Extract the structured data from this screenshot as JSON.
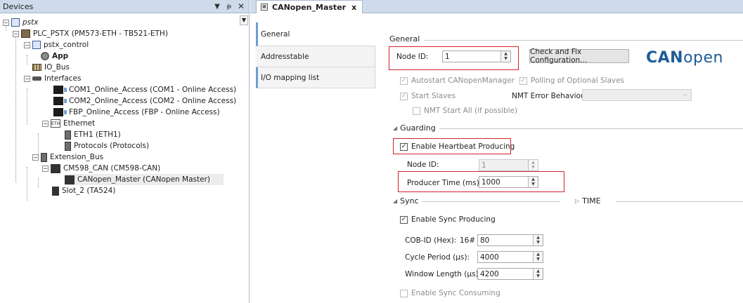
{
  "devices_panel": {
    "title": "Devices",
    "pin_icon": "pin-icon",
    "items": {
      "pstx": "pstx",
      "plc": "PLC_PSTX (PM573-ETH - TB521-ETH)",
      "pstx_control": "pstx_control",
      "app": "App",
      "io_bus": "IO_Bus",
      "interfaces": "Interfaces",
      "com1": "COM1_Online_Access (COM1 - Online Access)",
      "com2": "COM2_Online_Access (COM2 - Online Access)",
      "fbp": "FBP_Online_Access (FBP - Online Access)",
      "ethernet": "Ethernet",
      "eth1": "ETH1 (ETH1)",
      "protocols": "Protocols (Protocols)",
      "extension_bus": "Extension_Bus",
      "cm598": "CM598_CAN (CM598-CAN)",
      "canopen_master": "CANopen_Master (CANopen Master)",
      "slot2": "Slot_2 (TA524)"
    }
  },
  "editor": {
    "tab_title": "CANopen_Master",
    "tab_close": "x",
    "side_tabs": [
      "General",
      "Addresstable",
      "I/O mapping list"
    ],
    "general": {
      "section": "General",
      "node_id_label": "Node ID:",
      "node_id_value": "1",
      "check_fix_button": "Check and Fix Configuration...",
      "logo_can": "CAN",
      "logo_open": "open",
      "autostart": "Autostart CANopenManager",
      "polling": "Polling of Optional Slaves",
      "start_slaves": "Start Slaves",
      "nmt_error_label": "NMT Error Behaviour:",
      "nmt_start_all": "NMT Start All (if possible)"
    },
    "guarding": {
      "section": "Guarding",
      "enable_heartbeat": "Enable Heartbeat Producing",
      "node_id_label": "Node ID:",
      "node_id_value": "1",
      "producer_time_label": "Producer Time (ms):",
      "producer_time_value": "1000"
    },
    "sync": {
      "section": "Sync",
      "time_section": "TIME",
      "enable_sync": "Enable Sync Producing",
      "cob_id_label": "COB-ID (Hex):",
      "cob_id_prefix": "16#",
      "cob_id_value": "80",
      "cycle_label": "Cycle Period (µs):",
      "cycle_value": "4000",
      "window_label": "Window Length (µs):",
      "window_value": "4200",
      "enable_consuming": "Enable Sync Consuming"
    }
  },
  "colors": {
    "header_bg": "#cfdbea",
    "highlight_red": "#d3212b",
    "logo_blue": "#1d5c97",
    "tab_accent": "#6a9fd5"
  }
}
